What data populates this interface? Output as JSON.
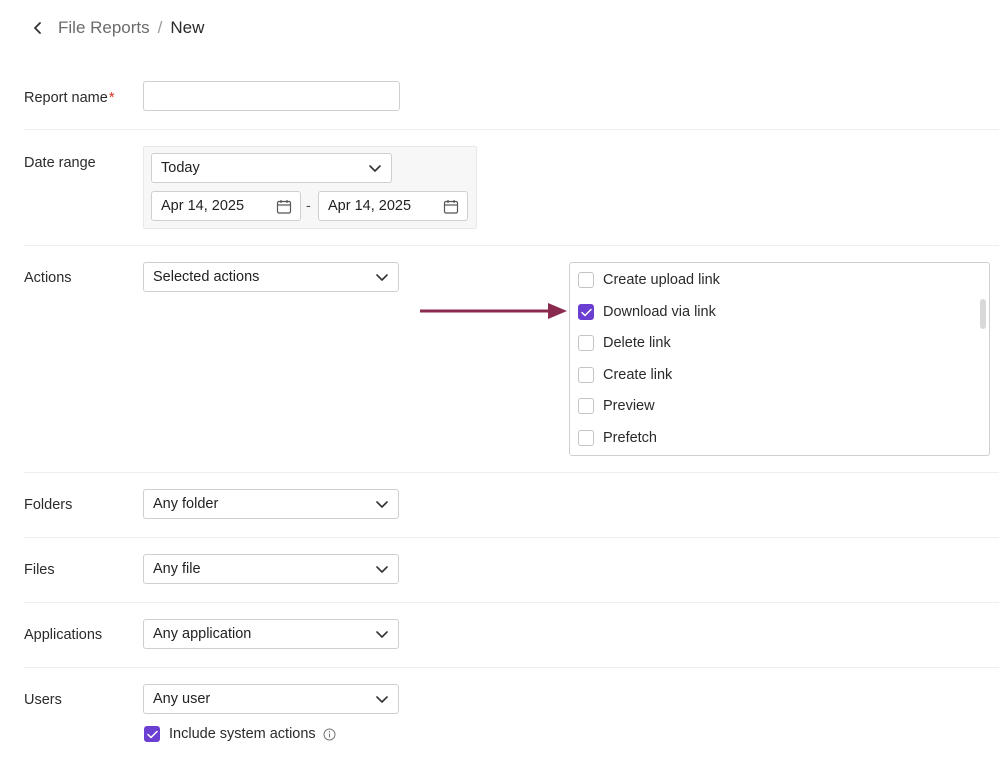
{
  "breadcrumb": {
    "back_icon": "chevron-left-icon",
    "parent": "File Reports",
    "separator": "/",
    "current": "New"
  },
  "form": {
    "report_name": {
      "label": "Report name",
      "required_mark": "*",
      "value": ""
    },
    "date_range": {
      "label": "Date range",
      "preset": "Today",
      "start": "Apr 14, 2025",
      "end": "Apr 14, 2025",
      "separator": "-"
    },
    "actions": {
      "label": "Actions",
      "selected": "Selected actions",
      "options": [
        {
          "label": "Create upload link",
          "checked": false
        },
        {
          "label": "Download via link",
          "checked": true
        },
        {
          "label": "Delete link",
          "checked": false
        },
        {
          "label": "Create link",
          "checked": false
        },
        {
          "label": "Preview",
          "checked": false
        },
        {
          "label": "Prefetch",
          "checked": false
        }
      ]
    },
    "folders": {
      "label": "Folders",
      "selected": "Any folder"
    },
    "files": {
      "label": "Files",
      "selected": "Any file"
    },
    "applications": {
      "label": "Applications",
      "selected": "Any application"
    },
    "users": {
      "label": "Users",
      "selected": "Any user"
    },
    "include_system_actions": {
      "label": "Include system actions",
      "checked": true,
      "info_icon": "info-circle-icon"
    }
  },
  "colors": {
    "accent": "#6a3fd1",
    "arrow": "#8b2a4f",
    "required": "#d93025"
  }
}
